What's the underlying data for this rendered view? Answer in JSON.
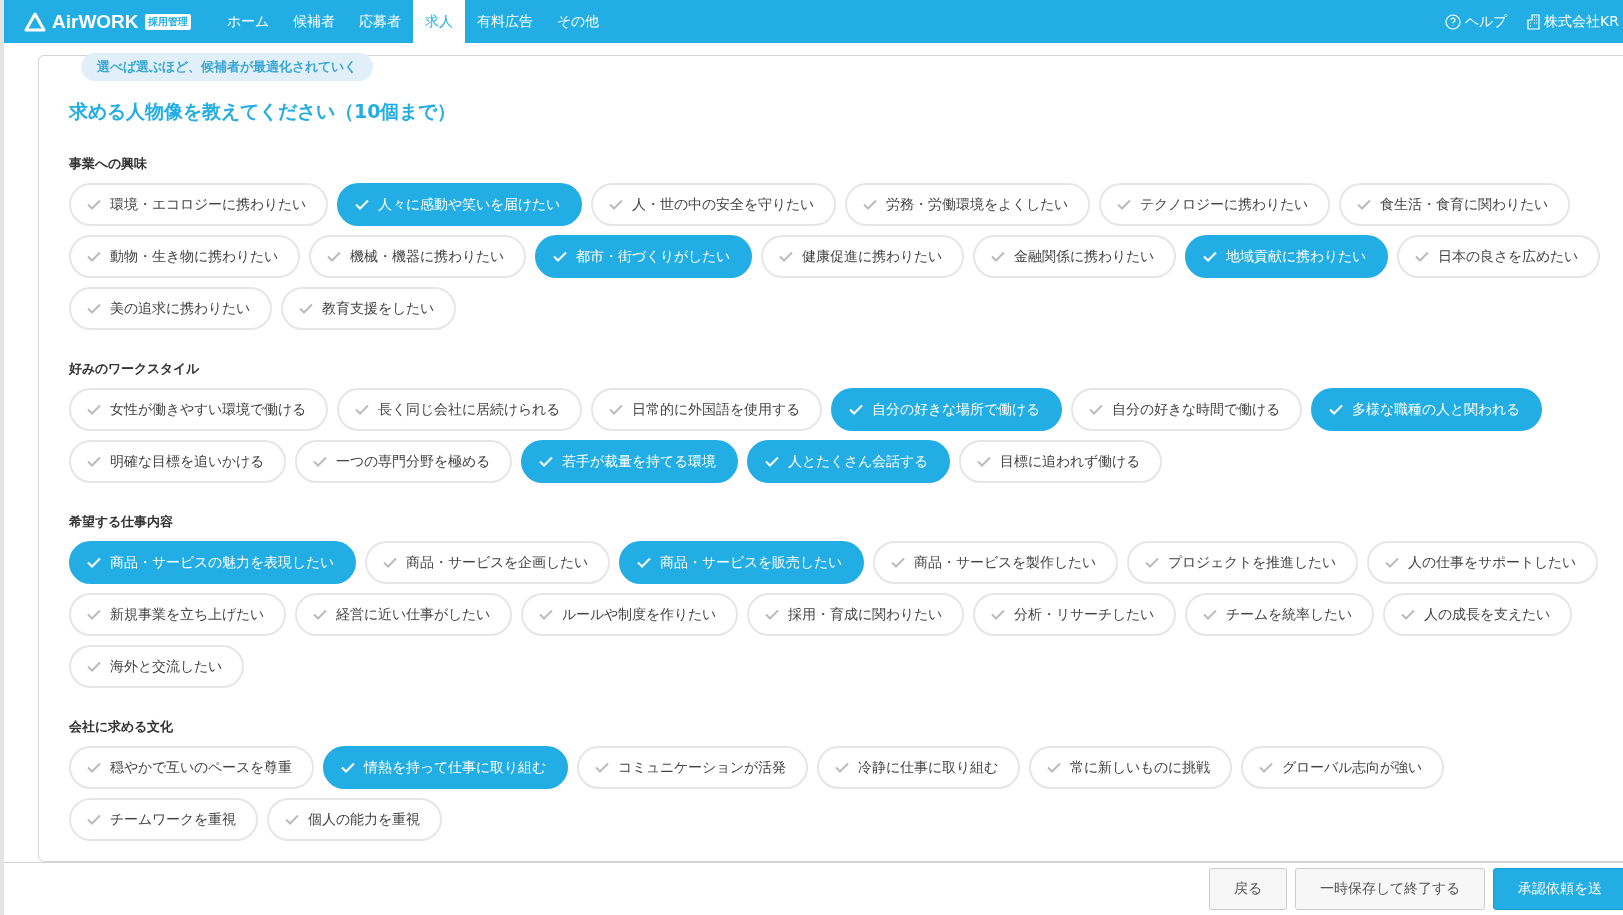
{
  "header": {
    "logo_text": "AirWORK",
    "logo_badge": "採用管理",
    "nav": [
      {
        "label": "ホーム",
        "selected": false
      },
      {
        "label": "候補者",
        "selected": false
      },
      {
        "label": "応募者",
        "selected": false
      },
      {
        "label": "求人",
        "selected": true
      },
      {
        "label": "有料広告",
        "selected": false
      },
      {
        "label": "その他",
        "selected": false
      }
    ],
    "help": "ヘルプ",
    "company": "株式会社KR"
  },
  "bubble": "選べば選ぶほど、候補者が最適化されていく",
  "title": "求める人物像を教えてください（10個まで）",
  "sections": [
    {
      "title": "事業への興味",
      "options": [
        {
          "label": "環境・エコロジーに携わりたい",
          "selected": false
        },
        {
          "label": "人々に感動や笑いを届けたい",
          "selected": true
        },
        {
          "label": "人・世の中の安全を守りたい",
          "selected": false
        },
        {
          "label": "労務・労働環境をよくしたい",
          "selected": false
        },
        {
          "label": "テクノロジーに携わりたい",
          "selected": false
        },
        {
          "label": "食生活・食育に関わりたい",
          "selected": false
        },
        {
          "label": "動物・生き物に携わりたい",
          "selected": false
        },
        {
          "label": "機械・機器に携わりたい",
          "selected": false
        },
        {
          "label": "都市・街づくりがしたい",
          "selected": true
        },
        {
          "label": "健康促進に携わりたい",
          "selected": false
        },
        {
          "label": "金融関係に携わりたい",
          "selected": false
        },
        {
          "label": "地域貢献に携わりたい",
          "selected": true
        },
        {
          "label": "日本の良さを広めたい",
          "selected": false
        },
        {
          "label": "美の追求に携わりたい",
          "selected": false
        },
        {
          "label": "教育支援をしたい",
          "selected": false
        }
      ]
    },
    {
      "title": "好みのワークスタイル",
      "options": [
        {
          "label": "女性が働きやすい環境で働ける",
          "selected": false
        },
        {
          "label": "長く同じ会社に居続けられる",
          "selected": false
        },
        {
          "label": "日常的に外国語を使用する",
          "selected": false
        },
        {
          "label": "自分の好きな場所で働ける",
          "selected": true
        },
        {
          "label": "自分の好きな時間で働ける",
          "selected": false
        },
        {
          "label": "多様な職種の人と関われる",
          "selected": true
        },
        {
          "label": "明確な目標を追いかける",
          "selected": false
        },
        {
          "label": "一つの専門分野を極める",
          "selected": false
        },
        {
          "label": "若手が裁量を持てる環境",
          "selected": true
        },
        {
          "label": "人とたくさん会話する",
          "selected": true
        },
        {
          "label": "目標に追われず働ける",
          "selected": false
        }
      ]
    },
    {
      "title": "希望する仕事内容",
      "options": [
        {
          "label": "商品・サービスの魅力を表現したい",
          "selected": true
        },
        {
          "label": "商品・サービスを企画したい",
          "selected": false
        },
        {
          "label": "商品・サービスを販売したい",
          "selected": true
        },
        {
          "label": "商品・サービスを製作したい",
          "selected": false
        },
        {
          "label": "プロジェクトを推進したい",
          "selected": false
        },
        {
          "label": "人の仕事をサポートしたい",
          "selected": false
        },
        {
          "label": "新規事業を立ち上げたい",
          "selected": false
        },
        {
          "label": "経営に近い仕事がしたい",
          "selected": false
        },
        {
          "label": "ルールや制度を作りたい",
          "selected": false
        },
        {
          "label": "採用・育成に関わりたい",
          "selected": false
        },
        {
          "label": "分析・リサーチしたい",
          "selected": false
        },
        {
          "label": "チームを統率したい",
          "selected": false
        },
        {
          "label": "人の成長を支えたい",
          "selected": false
        },
        {
          "label": "海外と交流したい",
          "selected": false
        }
      ]
    },
    {
      "title": "会社に求める文化",
      "options": [
        {
          "label": "穏やかで互いのペースを尊重",
          "selected": false
        },
        {
          "label": "情熱を持って仕事に取り組む",
          "selected": true
        },
        {
          "label": "コミュニケーションが活発",
          "selected": false
        },
        {
          "label": "冷静に仕事に取り組む",
          "selected": false
        },
        {
          "label": "常に新しいものに挑戦",
          "selected": false
        },
        {
          "label": "グローバル志向が強い",
          "selected": false
        },
        {
          "label": "チームワークを重視",
          "selected": false
        },
        {
          "label": "個人の能力を重視",
          "selected": false
        }
      ]
    }
  ],
  "footer": [
    {
      "label": "戻る",
      "kind": "secondary"
    },
    {
      "label": "一時保存して終了する",
      "kind": "secondary"
    },
    {
      "label": "承認依頼を送",
      "kind": "primary"
    }
  ]
}
